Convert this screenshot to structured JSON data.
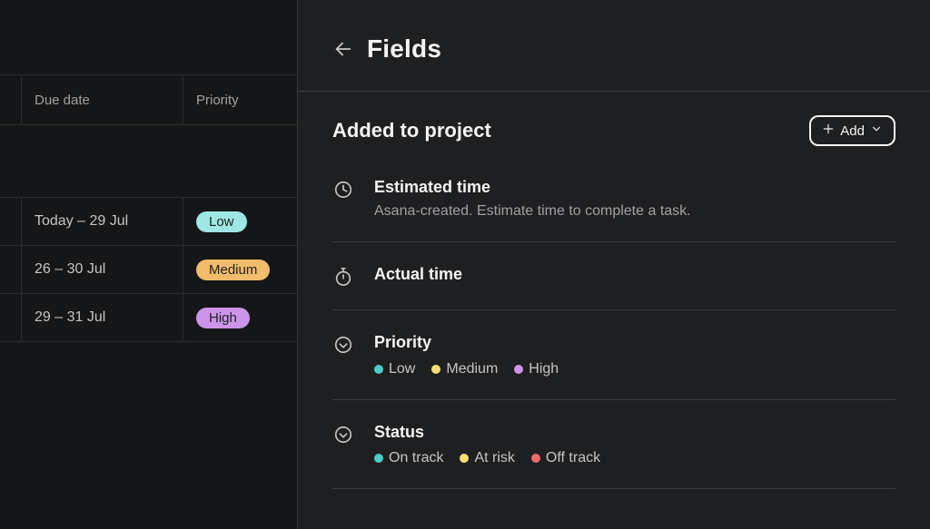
{
  "colors": {
    "low": "#9ee7e3",
    "medium": "#f1bd6c",
    "high": "#cd95ea",
    "on_track": "#4ecbc4",
    "at_risk": "#f8df72",
    "off_track": "#f06a6a"
  },
  "table": {
    "headers": {
      "due_date": "Due date",
      "priority": "Priority"
    },
    "rows": [
      {
        "due": "Today – 29 Jul",
        "priority_label": "Low",
        "priority_color_key": "low"
      },
      {
        "due": "26 – 30 Jul",
        "priority_label": "Medium",
        "priority_color_key": "medium"
      },
      {
        "due": "29 – 31 Jul",
        "priority_label": "High",
        "priority_color_key": "high"
      }
    ]
  },
  "panel": {
    "title": "Fields",
    "section_title": "Added to project",
    "add_label": "Add",
    "fields": [
      {
        "icon": "clock",
        "name": "Estimated time",
        "desc": "Asana-created. Estimate time to complete a task."
      },
      {
        "icon": "stopwatch",
        "name": "Actual time"
      },
      {
        "icon": "chevron-circle",
        "name": "Priority",
        "options": [
          {
            "label": "Low",
            "color_key": "on_track"
          },
          {
            "label": "Medium",
            "color_key": "at_risk"
          },
          {
            "label": "High",
            "color_key": "high"
          }
        ]
      },
      {
        "icon": "chevron-circle",
        "name": "Status",
        "options": [
          {
            "label": "On track",
            "color_key": "on_track"
          },
          {
            "label": "At risk",
            "color_key": "at_risk"
          },
          {
            "label": "Off track",
            "color_key": "off_track"
          }
        ]
      }
    ]
  }
}
